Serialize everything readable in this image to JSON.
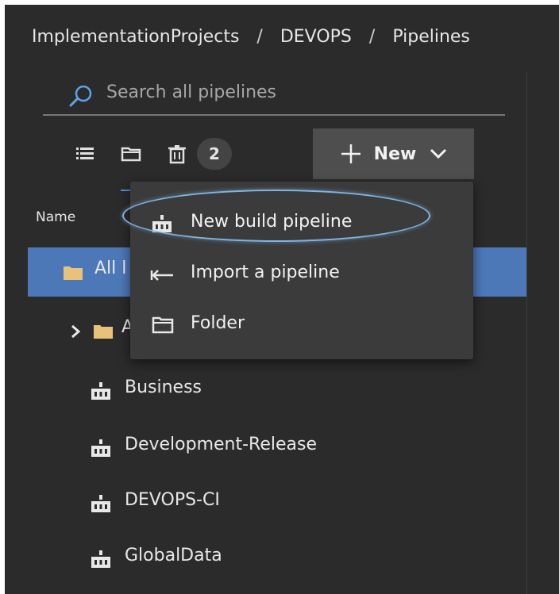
{
  "breadcrumb": {
    "items": [
      "ImplementationProjects",
      "DEVOPS",
      "Pipelines"
    ],
    "separator": "/"
  },
  "search": {
    "placeholder": "Search all pipelines",
    "icon": "search-icon"
  },
  "toolbar": {
    "icons": [
      "list-view-icon",
      "folder-view-icon",
      "trash-icon"
    ],
    "deleted_count": "2",
    "new_button_label": "New"
  },
  "list": {
    "column_header": "Name",
    "rows": [
      {
        "label": "All pipelines",
        "visible_text": "All l",
        "icon": "folder-icon",
        "selected": true
      },
      {
        "label": "A",
        "visible_text": "A",
        "icon": "folder-icon",
        "expandable": true
      },
      {
        "label": "Business",
        "icon": "build-pipeline-icon"
      },
      {
        "label": "Development-Release",
        "icon": "build-pipeline-icon"
      },
      {
        "label": "DEVOPS-CI",
        "icon": "build-pipeline-icon"
      },
      {
        "label": "GlobalData",
        "icon": "build-pipeline-icon"
      }
    ]
  },
  "new_menu": {
    "items": [
      {
        "label": "New build pipeline",
        "icon": "build-pipeline-icon",
        "highlighted": true
      },
      {
        "label": "Import a pipeline",
        "icon": "import-arrow-icon"
      },
      {
        "label": "Folder",
        "icon": "folder-outline-icon"
      }
    ]
  },
  "colors": {
    "background": "#2b2b2b",
    "selected_row": "#4d78b8",
    "accent": "#4a90d9",
    "folder": "#e8c27a",
    "menu_background": "#3b3b3b",
    "highlight_ring": "#7fb3e0"
  }
}
